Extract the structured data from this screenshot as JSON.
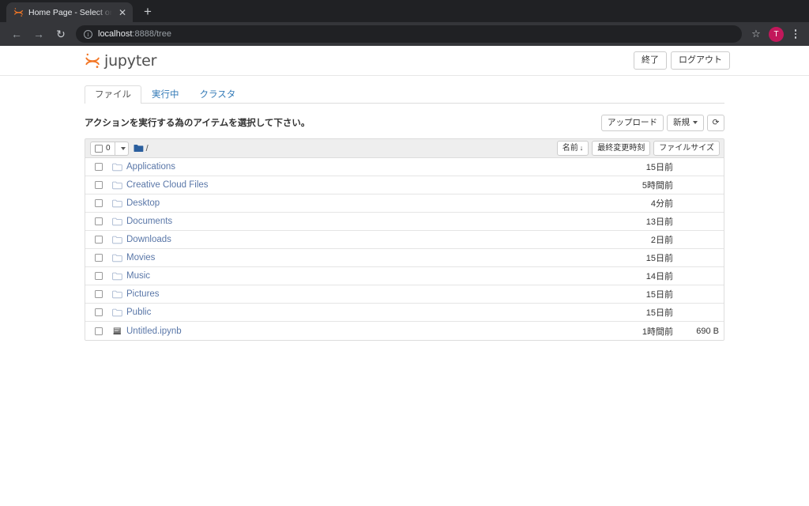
{
  "browser": {
    "tab_title": "Home Page - Select or create a",
    "tab_close_label": "✕",
    "newtab_label": "+",
    "back_label": "←",
    "forward_label": "→",
    "reload_label": "↻",
    "info_label": "i",
    "url_host": "localhost",
    "url_rest": ":8888/tree",
    "star_label": "☆",
    "avatar_label": "T",
    "favicon_name": "jupyter-favicon"
  },
  "jupyter": {
    "logo_text": "jupyter",
    "logo_color": "#f37726",
    "quit_label": "終了",
    "logout_label": "ログアウト",
    "tabs": [
      {
        "label": "ファイル",
        "active": true
      },
      {
        "label": "実行中",
        "active": false
      },
      {
        "label": "クラスタ",
        "active": false
      }
    ],
    "action_message": "アクションを実行する為のアイテムを選択して下さい。",
    "upload_label": "アップロード",
    "new_label": "新規",
    "refresh_label": "⟳",
    "selected_count": "0",
    "breadcrumb_root": "/",
    "col_name": "名前",
    "col_name_sort": "↓",
    "col_modified": "最終変更時刻",
    "col_size": "ファイルサイズ",
    "link_color": "#5a77a8"
  },
  "files": [
    {
      "name": "Applications",
      "icon": "folder-icon",
      "modified": "15日前",
      "size": ""
    },
    {
      "name": "Creative Cloud Files",
      "icon": "folder-icon",
      "modified": "5時間前",
      "size": ""
    },
    {
      "name": "Desktop",
      "icon": "folder-icon",
      "modified": "4分前",
      "size": ""
    },
    {
      "name": "Documents",
      "icon": "folder-icon",
      "modified": "13日前",
      "size": ""
    },
    {
      "name": "Downloads",
      "icon": "folder-icon",
      "modified": "2日前",
      "size": ""
    },
    {
      "name": "Movies",
      "icon": "folder-icon",
      "modified": "15日前",
      "size": ""
    },
    {
      "name": "Music",
      "icon": "folder-icon",
      "modified": "14日前",
      "size": ""
    },
    {
      "name": "Pictures",
      "icon": "folder-icon",
      "modified": "15日前",
      "size": ""
    },
    {
      "name": "Public",
      "icon": "folder-icon",
      "modified": "15日前",
      "size": ""
    },
    {
      "name": "Untitled.ipynb",
      "icon": "notebook-icon",
      "modified": "1時間前",
      "size": "690 B"
    }
  ]
}
